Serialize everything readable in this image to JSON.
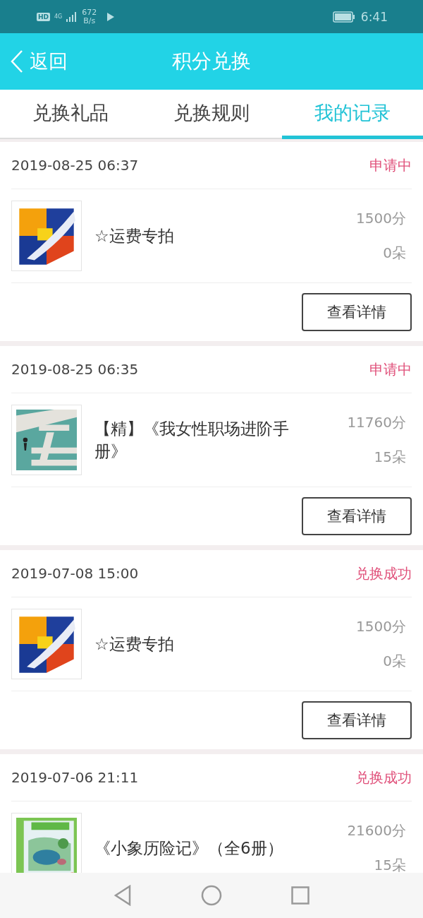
{
  "status_bar": {
    "network": "4G",
    "speed": "672",
    "speed_unit": "B/s",
    "time": "6:41",
    "hd": "HD"
  },
  "header": {
    "back": "返回",
    "title": "积分兑换"
  },
  "tabs": [
    {
      "label": "兑换礼品",
      "selected": false
    },
    {
      "label": "兑换规则",
      "selected": false
    },
    {
      "label": "我的记录",
      "selected": true
    }
  ],
  "records": [
    {
      "date": "2019-08-25 06:37",
      "status": "申请中",
      "title": "☆运费专拍",
      "points": "1500分",
      "flowers": "0朵",
      "button": "查看详情",
      "kind": "picture"
    },
    {
      "date": "2019-08-25 06:35",
      "status": "申请中",
      "title": "【精】《我女性职场进阶手册》",
      "points": "11760分",
      "flowers": "15朵",
      "button": "查看详情",
      "kind": "picture"
    },
    {
      "date": "2019-07-08 15:00",
      "status": "兑换成功",
      "title": "☆运费专拍",
      "points": "1500分",
      "flowers": "0朵",
      "button": "查看详情",
      "kind": "picture"
    },
    {
      "date": "2019-07-06 21:11",
      "status": "兑换成功",
      "title": "《小象历险记》（全6册）",
      "points": "21600分",
      "flowers": "15朵",
      "kind": "picture"
    }
  ]
}
